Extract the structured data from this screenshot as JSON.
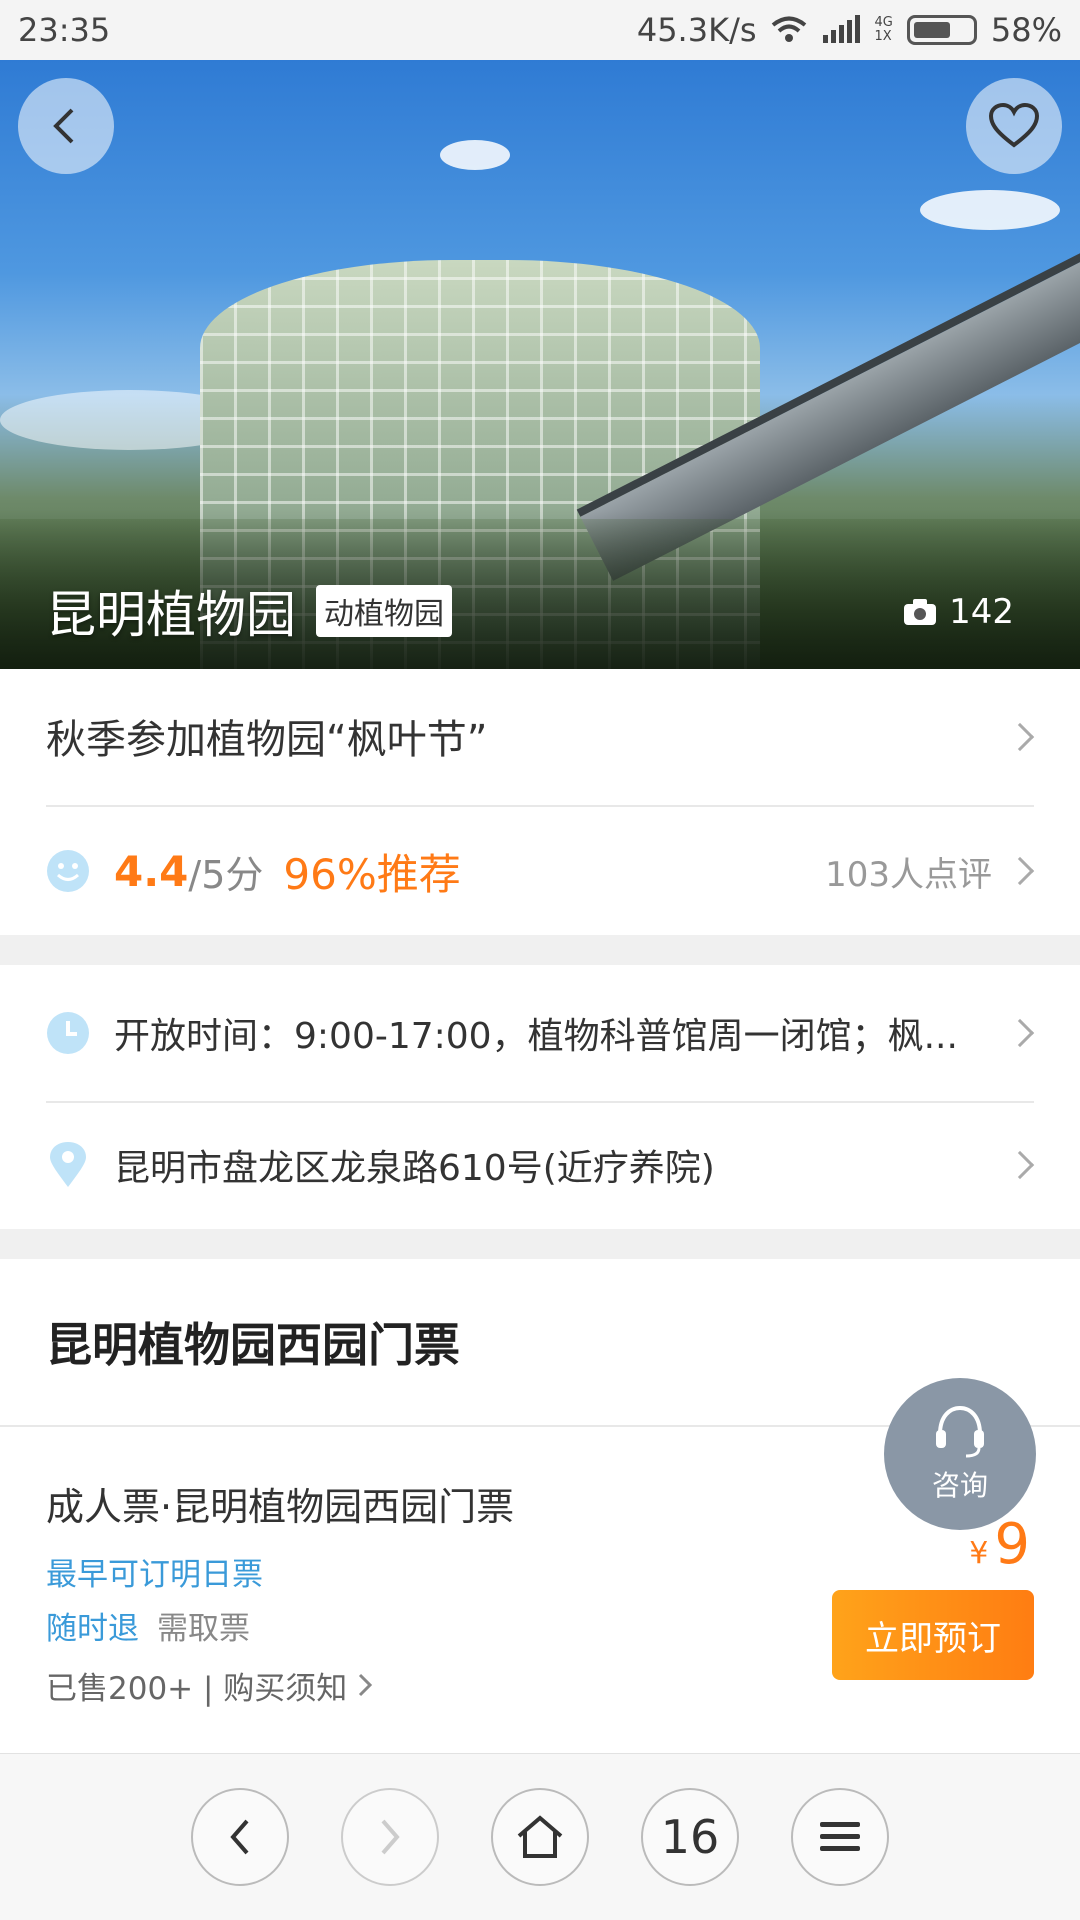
{
  "status_bar": {
    "time": "23:35",
    "speed": "45.3K/s",
    "network_top": "4G",
    "network_bottom": "1X",
    "battery": "58%"
  },
  "hero": {
    "title": "昆明植物园",
    "category_tag": "动植物园",
    "photo_count": "142",
    "back_icon": "chevron-left-icon",
    "favorite_icon": "heart-icon"
  },
  "promo": {
    "text": "秋季参加植物园“枫叶节”"
  },
  "rating": {
    "score": "4.4",
    "scale": "/5分",
    "recommend": "96%推荐",
    "reviews": "103人点评"
  },
  "info": {
    "hours": "开放时间：9:00-17:00，植物科普馆周一闭馆；枫...",
    "address": "昆明市盘龙区龙泉路610号(近疗养院)"
  },
  "tickets": {
    "section_title": "昆明植物园西园门票",
    "item": {
      "name": "成人票·昆明植物园西园门票",
      "earliest": "最早可订明日票",
      "refund": "随时退",
      "pickup": "需取票",
      "sold": "已售200+ | 购买须知",
      "currency": "¥",
      "price": "9",
      "book_label": "立即预订"
    },
    "consult_label": "咨询"
  },
  "bottom_nav": {
    "tab_count": "16"
  },
  "colors": {
    "accent_orange": "#ff7a16",
    "link_blue": "#3a9ad9"
  }
}
